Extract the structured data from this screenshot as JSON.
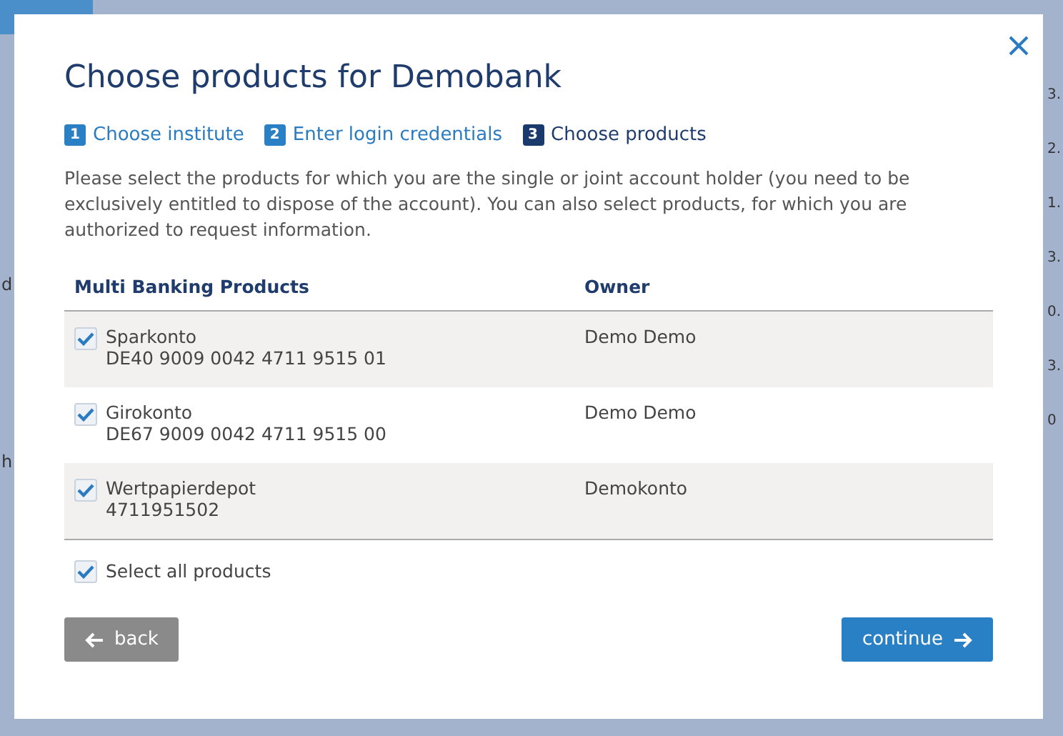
{
  "background": {
    "left_fragments": [
      "d",
      "h"
    ],
    "right_fragments": [
      "3.",
      "2.",
      "1.",
      "3.",
      "0.",
      "3.",
      "0"
    ]
  },
  "dialog": {
    "title": "Choose products for Demobank",
    "steps": [
      {
        "number": "1",
        "label": "Choose institute",
        "selected": false
      },
      {
        "number": "2",
        "label": "Enter login credentials",
        "selected": false
      },
      {
        "number": "3",
        "label": "Choose products",
        "selected": true
      }
    ],
    "intro": "Please select the products for which you are the single or joint account holder (you need to be exclusively entitled to dispose of the account). You can also select products, for which you are authorized to request information.",
    "table": {
      "columns": [
        "Multi Banking Products",
        "Owner"
      ],
      "rows": [
        {
          "name": "Sparkonto",
          "account": "DE40 9009 0042 4711 9515 01",
          "owner": "Demo Demo",
          "checked": true
        },
        {
          "name": "Girokonto",
          "account": "DE67 9009 0042 4711 9515 00",
          "owner": "Demo Demo",
          "checked": true
        },
        {
          "name": "Wertpapierdepot",
          "account": "4711951502",
          "owner": "Demokonto",
          "checked": true
        }
      ]
    },
    "select_all": {
      "label": "Select all products",
      "checked": true
    },
    "buttons": {
      "back": "back",
      "continue": "continue"
    }
  }
}
